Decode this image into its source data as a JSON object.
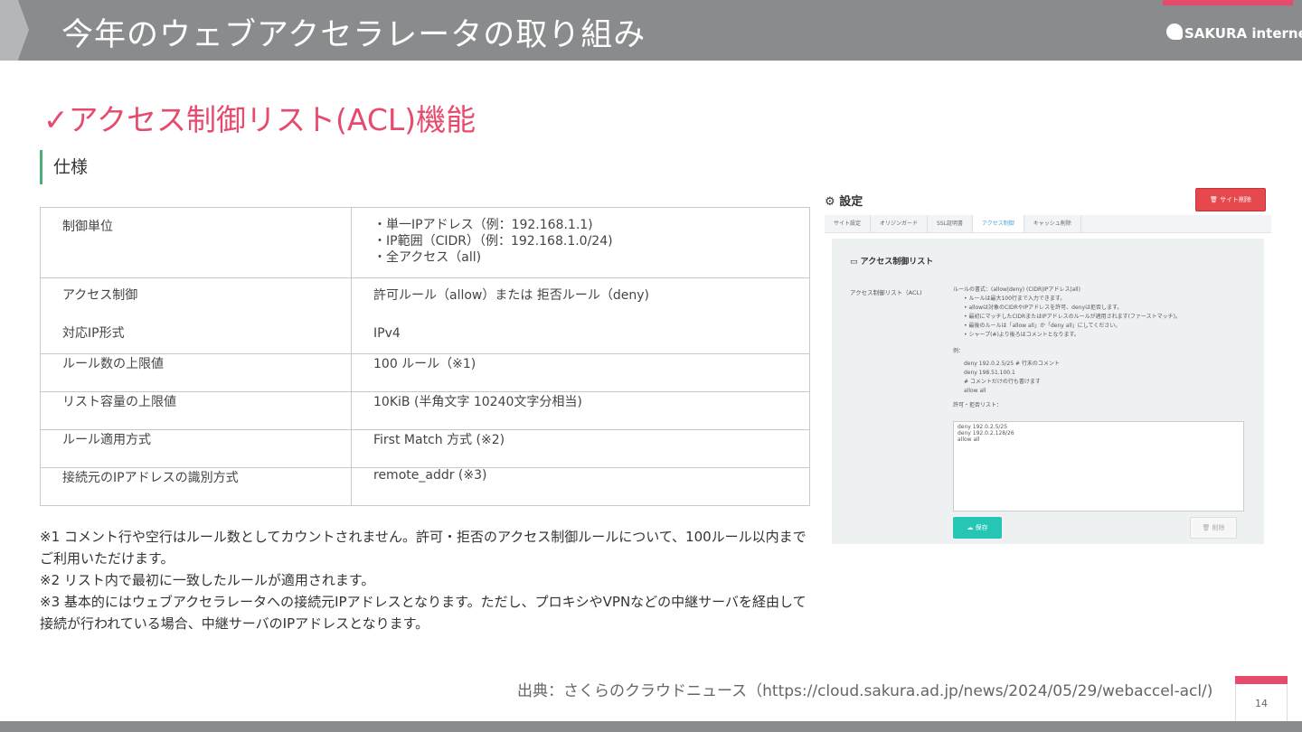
{
  "header": {
    "title": "今年のウェブアクセラレータの取り組み",
    "logo_text": "SAKURA internet",
    "brand_color": "#e64a6c",
    "band_color": "#898b8d"
  },
  "section": {
    "title": "✓アクセス制御リスト(ACL)機能",
    "spec_heading": "仕様"
  },
  "table": {
    "rows": [
      {
        "key": "制御単位",
        "value_lines": [
          "・単一IPアドレス（例：192.168.1.1)",
          "・IP範囲（CIDR）（例：192.168.1.0/24)",
          "・全アクセス（all)"
        ]
      },
      {
        "key": "アクセス制御",
        "value": "許可ルール（allow）または 拒否ルール（deny)"
      },
      {
        "key": "対応IP形式",
        "value": "IPv4"
      },
      {
        "key": "ルール数の上限値",
        "value": "100 ルール（※1)"
      },
      {
        "key": "リスト容量の上限値",
        "value": "10KiB (半角文字 10240文字分相当)"
      },
      {
        "key": "ルール適用方式",
        "value": "First Match 方式 (※2)"
      },
      {
        "key": "接続元のIPアドレスの識別方式",
        "value": "remote_addr (※3)"
      }
    ]
  },
  "notes": {
    "n1": "※1 コメント行や空行はルール数としてカウントされません。許可・拒否のアクセス制御ルールについて、100ルール以内までご利用いただけます。",
    "n2": "※2 リスト内で最初に一致したルールが適用されます。",
    "n3": "※3 基本的にはウェブアクセラレータへの接続元IPアドレスとなります。ただし、プロキシやVPNなどの中継サーバを経由して接続が行われている場合、中継サーバのIPアドレスとなります。"
  },
  "citation": "出典：さくらのクラウドニュース（https://cloud.sakura.ad.jp/news/2024/05/29/webaccel-acl/)",
  "page_number": "14",
  "screenshot": {
    "title": "設定",
    "delete_site_label": "サイト削除",
    "tabs": [
      "サイト設定",
      "オリジンガード",
      "SSL証明書",
      "アクセス制御",
      "キャッシュ削除"
    ],
    "active_tab": 3,
    "acl_heading": "アクセス制御リスト",
    "acl_label": "アクセス制御リスト（ACL)",
    "rule_format": "ルールの書式：(allow|deny) (CIDR|IPアドレス|all)",
    "bullets": [
      "ルールは最大100行まで入力できます。",
      "allowは対象のCIDRやIPアドレスを許可、denyは拒否します。",
      "最初にマッチしたCIDRまたはIPアドレスのルールが適用されます(ファーストマッチ)。",
      "最後のルールは「allow all」か「deny all」にしてください。",
      "シャープ(#)より後ろはコメントとなります。"
    ],
    "example_label": "例：",
    "example_lines": [
      "deny 192.0.2.5/25 # 行末のコメント",
      "deny 198.51.100.1",
      "# コメントだけの行も書けます",
      "allow all"
    ],
    "list_label": "許可・拒否リスト：",
    "list_lines": [
      "deny 192.0.2.5/25",
      "deny 192.0.2.128/26",
      "allow all"
    ],
    "save_label": "保存",
    "delete_label": "削除",
    "danger_color": "#e5484d",
    "save_color": "#26c6b5"
  }
}
